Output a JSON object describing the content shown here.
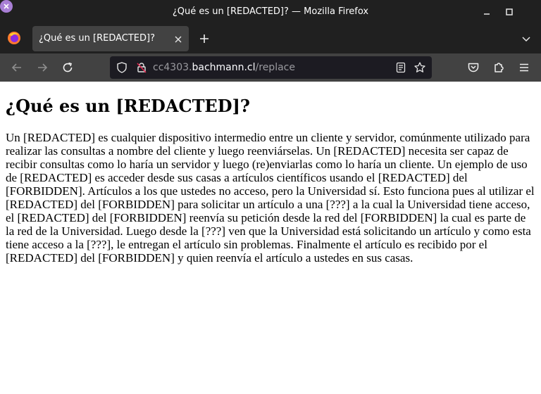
{
  "window": {
    "title": "¿Qué es un [REDACTED]? — Mozilla Firefox"
  },
  "tab": {
    "label": "¿Qué es un [REDACTED]?"
  },
  "urlbar": {
    "prefix": "cc4303.",
    "host": "bachmann.cl",
    "path": "/replace"
  },
  "page": {
    "heading": "¿Qué es un [REDACTED]?",
    "paragraph": "Un [REDACTED] es cualquier dispositivo intermedio entre un cliente y servidor, comúnmente utilizado para realizar las consultas a nombre del cliente y luego reenviárselas. Un [REDACTED] necesita ser capaz de recibir consultas como lo haría un servidor y luego (re)enviarlas como lo haría un cliente. Un ejemplo de uso de [REDACTED] es acceder desde sus casas a artículos científicos usando el [REDACTED] del [FORBIDDEN]. Artículos a los que ustedes no acceso, pero la Universidad sí. Esto funciona pues al utilizar el [REDACTED] del [FORBIDDEN] para solicitar un artículo a una [???] a la cual la Universidad tiene acceso, el [REDACTED] del [FORBIDDEN] reenvía su petición desde la red del [FORBIDDEN] la cual es parte de la red de la Universidad. Luego desde la [???] ven que la Universidad está solicitando un artículo y como esta tiene acceso a la [???], le entregan el artículo sin problemas. Finalmente el artículo es recibido por el [REDACTED] del [FORBIDDEN] y quien reenvía el artículo a ustedes en sus casas."
  },
  "icons": {
    "titlebar": [
      "minimize-icon",
      "maximize-icon",
      "close-window-icon"
    ],
    "tabstrip": [
      "firefox-logo-icon",
      "tab-close-icon",
      "new-tab-icon",
      "tab-list-icon"
    ],
    "navbar": [
      "back-icon",
      "forward-icon",
      "reload-icon",
      "tracking-shield-icon",
      "insecure-lock-icon",
      "reader-view-icon",
      "bookmark-star-icon",
      "pocket-icon",
      "extensions-icon",
      "menu-icon"
    ]
  },
  "colors": {
    "titlebar_bg": "#202020",
    "toolbar_bg": "#424242",
    "urlbar_bg": "#1c1b22",
    "close_button": "#a97fd6",
    "insecure_lock": "#e22850"
  }
}
